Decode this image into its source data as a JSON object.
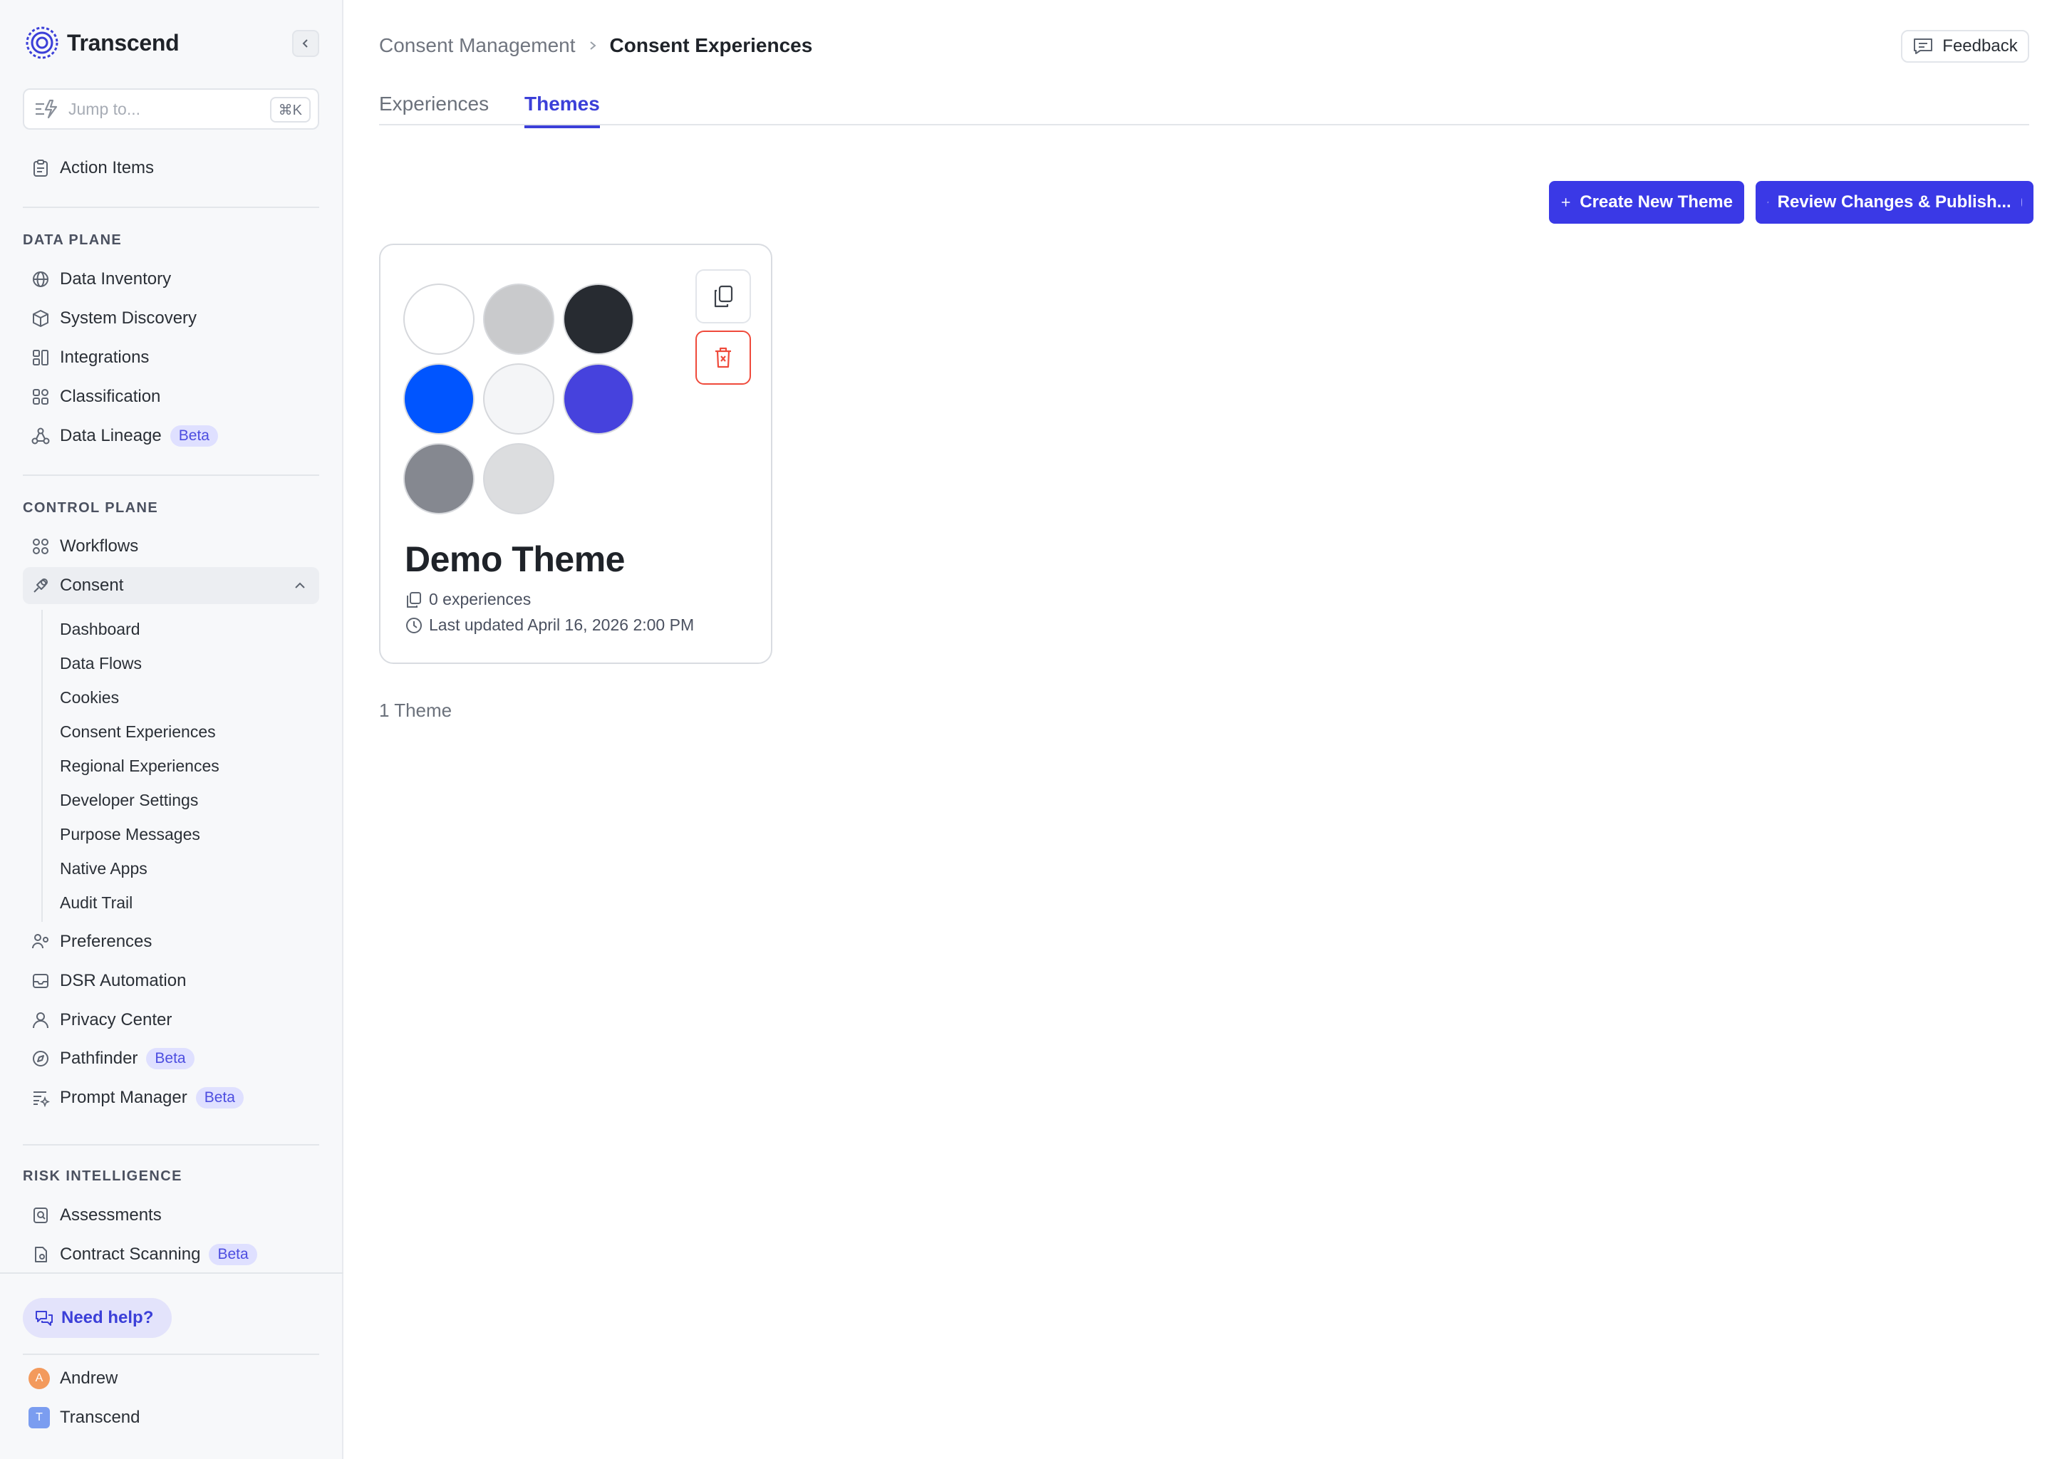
{
  "brand": {
    "name": "Transcend"
  },
  "search": {
    "placeholder": "Jump to...",
    "shortcut": "⌘K"
  },
  "sidebar": {
    "action_items": "Action Items",
    "sections": {
      "data_plane": "DATA PLANE",
      "control_plane": "CONTROL PLANE",
      "risk_intelligence": "RISK INTELLIGENCE"
    },
    "data_plane_items": [
      {
        "label": "Data Inventory",
        "icon": "globe-icon"
      },
      {
        "label": "System Discovery",
        "icon": "cube-icon"
      },
      {
        "label": "Integrations",
        "icon": "integrations-icon"
      },
      {
        "label": "Classification",
        "icon": "classification-icon"
      },
      {
        "label": "Data Lineage",
        "icon": "lineage-icon",
        "badge": "Beta"
      }
    ],
    "control_plane_items": [
      {
        "label": "Workflows",
        "icon": "workflows-icon"
      },
      {
        "label": "Consent",
        "icon": "consent-icon"
      }
    ],
    "consent_subitems": [
      "Dashboard",
      "Data Flows",
      "Cookies",
      "Consent Experiences",
      "Regional Experiences",
      "Developer Settings",
      "Purpose Messages",
      "Native Apps",
      "Audit Trail"
    ],
    "control_plane_more": [
      {
        "label": "Preferences",
        "icon": "preferences-icon"
      },
      {
        "label": "DSR Automation",
        "icon": "inbox-icon"
      },
      {
        "label": "Privacy Center",
        "icon": "user-icon"
      },
      {
        "label": "Pathfinder",
        "icon": "compass-icon",
        "badge": "Beta"
      },
      {
        "label": "Prompt Manager",
        "icon": "prompt-icon",
        "badge": "Beta"
      }
    ],
    "risk_items": [
      {
        "label": "Assessments",
        "icon": "assessment-icon"
      },
      {
        "label": "Contract Scanning",
        "icon": "contract-icon",
        "badge": "Beta"
      }
    ],
    "help": "Need help?",
    "user": {
      "name": "Andrew",
      "initial": "A"
    },
    "org": {
      "name": "Transcend",
      "initial": "T"
    }
  },
  "header": {
    "breadcrumb_parent": "Consent Management",
    "breadcrumb_current": "Consent Experiences",
    "feedback": "Feedback"
  },
  "tabs": [
    {
      "label": "Experiences",
      "active": false
    },
    {
      "label": "Themes",
      "active": true
    }
  ],
  "actions": {
    "create": "Create New Theme",
    "review": "Review Changes & Publish..."
  },
  "theme_card": {
    "name": "Demo Theme",
    "experiences": "0 experiences",
    "updated": "Last updated April 16, 2026 2:00 PM",
    "colors": [
      "#ffffff",
      "#c9cacc",
      "#272b31",
      "#0055ff",
      "#f4f5f7",
      "#4642dd",
      "#858890",
      "#dcdddf"
    ]
  },
  "footer_count": "1 Theme",
  "colors": {
    "accent": "#3a39e6",
    "danger": "#ef4a3b",
    "badge_bg": "#dfe0ff"
  }
}
